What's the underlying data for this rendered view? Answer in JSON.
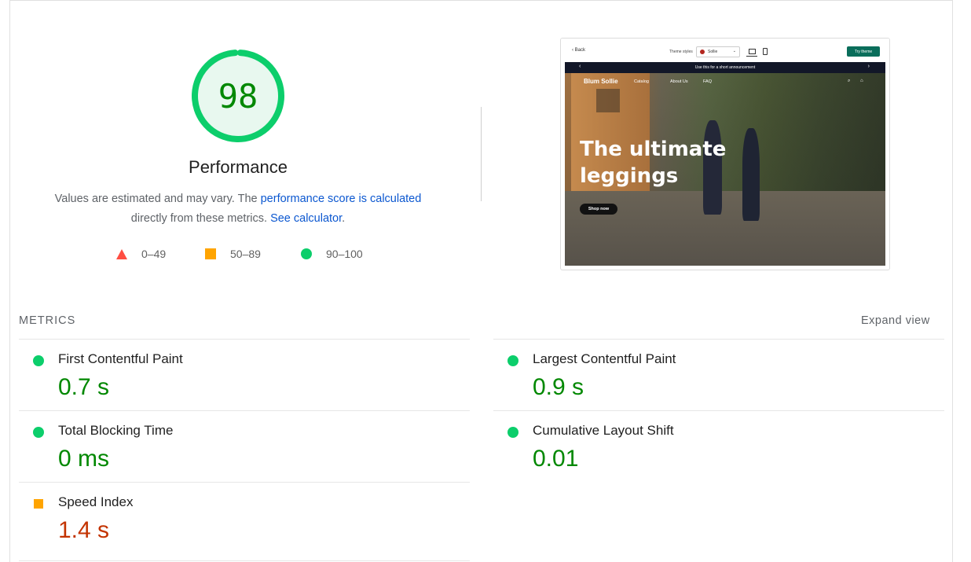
{
  "gauge": {
    "score": "98",
    "fraction": 0.98,
    "color": "#0cce6b",
    "fill": "#e8f8ef"
  },
  "category": {
    "label": "Performance"
  },
  "description": {
    "prefix": "Values are estimated and may vary. The ",
    "link1": "performance score is calculated",
    "middle": " directly from these metrics. ",
    "link2": "See calculator",
    "suffix": "."
  },
  "legend": [
    {
      "shape": "triangle-icon",
      "range": "0–49",
      "color": "#ff4e42"
    },
    {
      "shape": "square-icon",
      "range": "50–89",
      "color": "#ffa400"
    },
    {
      "shape": "circle-icon",
      "range": "90–100",
      "color": "#0cce6b"
    }
  ],
  "thumbnail": {
    "back": "Back",
    "theme_styles": "Theme styles",
    "theme_value": "Sollie",
    "try_theme": "Try theme",
    "announcement": "Use this for a short announcement",
    "brand": "Blum Sollie",
    "nav": [
      "Catalog",
      "About Us",
      "FAQ"
    ],
    "hero_title": "The ultimate leggings",
    "shop_now": "Shop now"
  },
  "metrics": {
    "title": "METRICS",
    "expand_label": "Expand view",
    "items": [
      {
        "name": "First Contentful Paint",
        "value": "0.7 s",
        "status": "good"
      },
      {
        "name": "Largest Contentful Paint",
        "value": "0.9 s",
        "status": "good"
      },
      {
        "name": "Total Blocking Time",
        "value": "0 ms",
        "status": "good"
      },
      {
        "name": "Cumulative Layout Shift",
        "value": "0.01",
        "status": "good"
      },
      {
        "name": "Speed Index",
        "value": "1.4 s",
        "status": "average"
      }
    ]
  }
}
